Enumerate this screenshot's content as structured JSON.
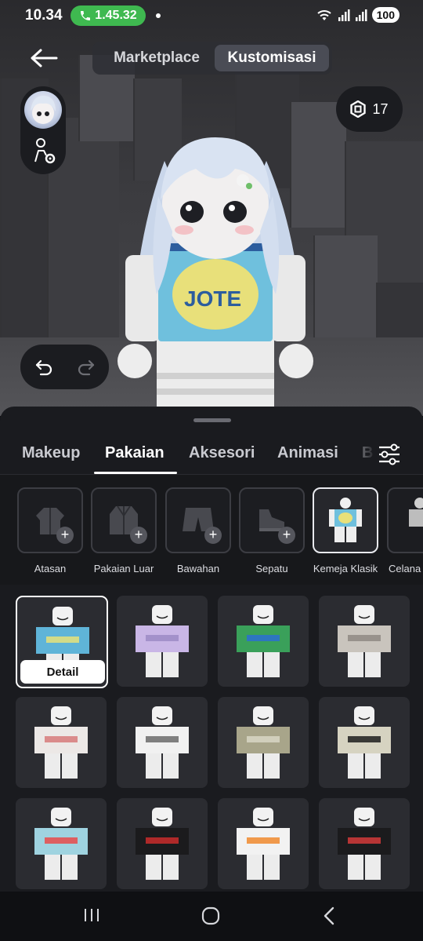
{
  "status": {
    "time": "10.34",
    "call_duration": "1.45.32",
    "battery": "100"
  },
  "header": {
    "tabs": [
      "Marketplace",
      "Kustomisasi"
    ],
    "active_tab": "Kustomisasi"
  },
  "robux": {
    "amount": "17"
  },
  "sheet": {
    "tabs": [
      "Makeup",
      "Pakaian",
      "Aksesori",
      "Animasi",
      "B"
    ],
    "active_tab": "Pakaian",
    "categories": [
      {
        "label": "Atasan",
        "icon": "jacket-icon"
      },
      {
        "label": "Pakaian Luar",
        "icon": "coat-icon"
      },
      {
        "label": "Bawahan",
        "icon": "shorts-icon"
      },
      {
        "label": "Sepatu",
        "icon": "shoe-icon"
      },
      {
        "label": "Kemeja Klasik",
        "icon": "classic-shirt-thumb"
      },
      {
        "label": "Celana",
        "icon": "classic-pants-thumb"
      }
    ],
    "selected_category": "Kemeja Klasik",
    "detail_label": "Detail",
    "items": [
      {
        "shirt": "#5fb4d8",
        "accent": "#e6e27a",
        "selected": true
      },
      {
        "shirt": "#c9b6e6",
        "accent": "#9c8bc4"
      },
      {
        "shirt": "#3aa05a",
        "accent": "#2c6fd1"
      },
      {
        "shirt": "#c9c4bd",
        "accent": "#8f8a84"
      },
      {
        "shirt": "#ece8e6",
        "accent": "#d77a7a"
      },
      {
        "shirt": "#f1f1f1",
        "accent": "#6b6b6b"
      },
      {
        "shirt": "#a8a58a",
        "accent": "#d8d6c4"
      },
      {
        "shirt": "#d6d3c1",
        "accent": "#1d1d1d"
      },
      {
        "shirt": "#9fd3e0",
        "accent": "#e84a4a"
      },
      {
        "shirt": "#1b1b1d",
        "accent": "#c92b2b"
      },
      {
        "shirt": "#f2f2f2",
        "accent": "#f08a2e"
      },
      {
        "shirt": "#1b1b1d",
        "accent": "#d23a3a"
      }
    ]
  }
}
